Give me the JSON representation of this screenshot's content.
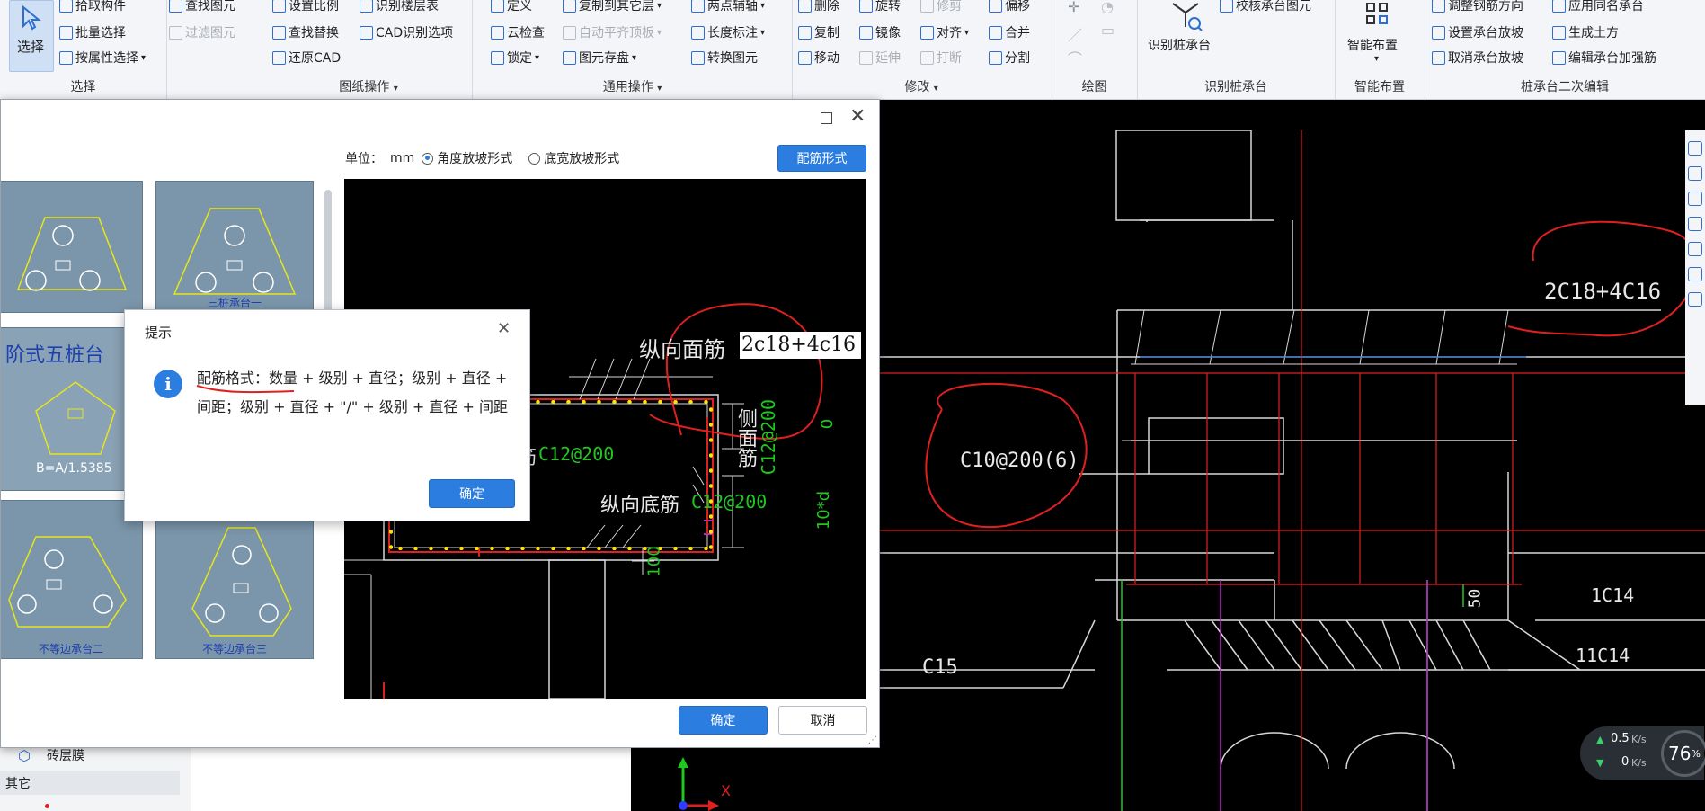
{
  "ribbon": {
    "select_btn": "选择",
    "groups": [
      {
        "title": "选择",
        "items": [
          "拾取构件",
          "批量选择",
          "按属性选择"
        ]
      },
      {
        "title": "图纸操作",
        "items": [
          "设置比例",
          "查找替换",
          "还原CAD",
          "查找图元",
          "识别楼层表",
          "过滤图元",
          "CAD识别选项"
        ]
      },
      {
        "title": "通用操作",
        "items": [
          "定义",
          "云检查",
          "锁定",
          "复制到其它层",
          "自动平齐顶板",
          "图元存盘",
          "两点辅轴",
          "长度标注",
          "转换图元"
        ]
      },
      {
        "title": "修改",
        "items": [
          "删除",
          "复制",
          "移动",
          "旋转",
          "镜像",
          "延伸",
          "修剪",
          "对齐",
          "打断",
          "偏移",
          "合并",
          "分割"
        ]
      },
      {
        "title": "绘图",
        "items": []
      },
      {
        "title": "识别桩承台",
        "items": [
          "识别桩承台",
          "校核承台图元"
        ]
      },
      {
        "title": "智能布置",
        "items": [
          "智能布置"
        ]
      },
      {
        "title": "桩承台二次编辑",
        "items": [
          "调整钢筋方向",
          "设置承台放坡",
          "取消承台放坡",
          "应用同名承台",
          "生成土方",
          "编辑承台加强筋"
        ]
      }
    ]
  },
  "dialog": {
    "unit_label": "单位：",
    "unit_value": "mm",
    "radio1": "角度放坡形式",
    "radio2": "底宽放坡形式",
    "rebar_btn": "配筋形式",
    "ok_btn": "确定",
    "cancel_btn": "取消",
    "thumbs": [
      {
        "caption": ""
      },
      {
        "caption": "三桩承台一"
      },
      {
        "caption": ""
      },
      {
        "caption": "阶式五桩台",
        "sub": "B=A/1.5385"
      },
      {
        "caption": "不等边承台二"
      },
      {
        "caption": "不等边承台三"
      }
    ],
    "preview": {
      "top_label": "纵向面筋",
      "top_value": "2c18+4c16",
      "side_label": "侧面筋",
      "side_value": "C12@200",
      "bottom_label": "纵向底筋",
      "bottom_value": "C12@200",
      "tie_value": "C12@200",
      "tie_partial": "筋",
      "dim_0": "0",
      "dim_10d": "10*d",
      "dim_100": "100"
    }
  },
  "tip": {
    "title": "提示",
    "message": "配筋格式：数量 + 级别 + 直径；级别 + 直径 + 间距；级别 + 直径 + \"/\" + 级别 + 直径 + 间距",
    "ok_btn": "确定"
  },
  "cad": {
    "label_top": "2C18+4C16",
    "label_stirrup": "C10@200(6)",
    "label_c15": "C15",
    "label_1c14": "1C14",
    "label_11c14": "11C14",
    "label_50": "50"
  },
  "left_panel": {
    "item1": "砖层膜",
    "item2": "其它"
  },
  "net": {
    "up": "0.5",
    "up_unit": "K/s",
    "down": "0",
    "down_unit": "K/s",
    "percent": "76",
    "percent_sign": "%"
  },
  "axis": {
    "x_label": "X"
  },
  "colors": {
    "accent": "#2b7de0",
    "annotation": "#e02020",
    "cad_green": "#1fc81f"
  }
}
